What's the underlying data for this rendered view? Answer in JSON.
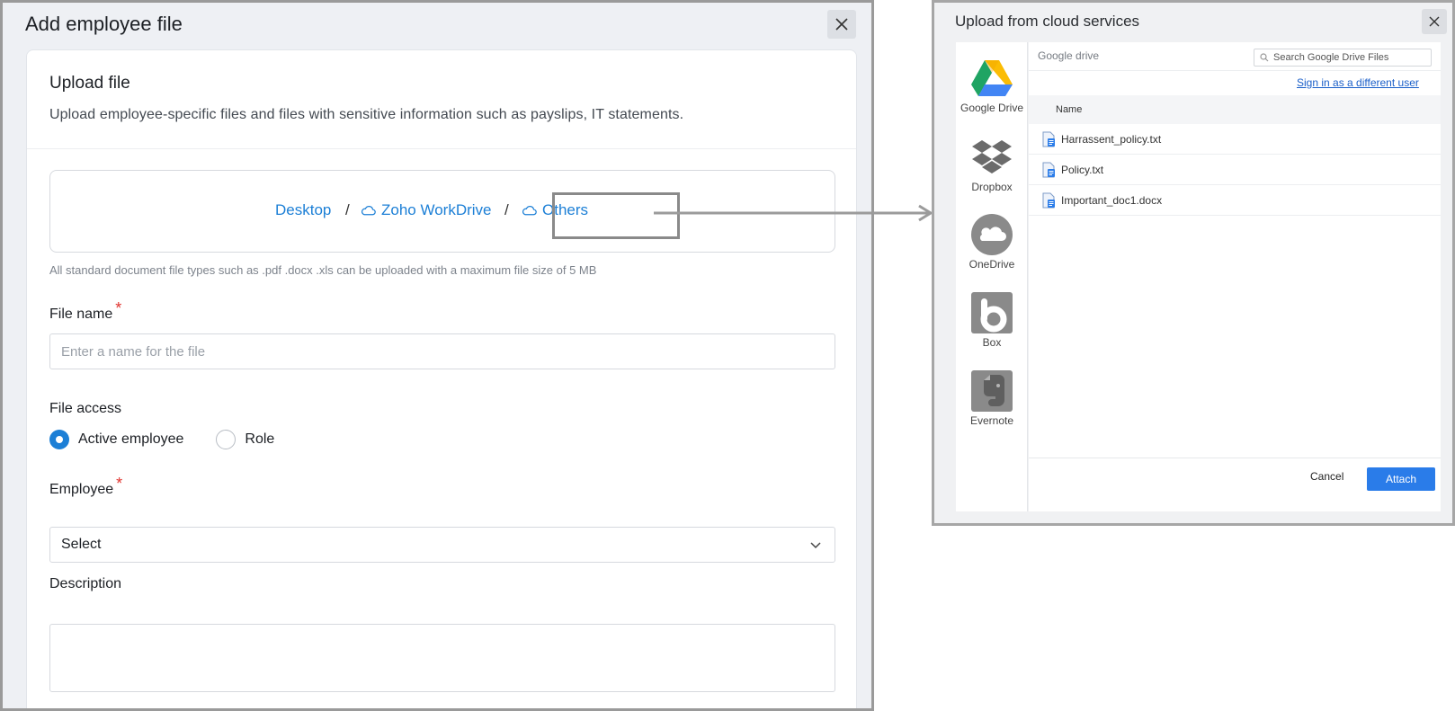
{
  "left_panel": {
    "title": "Add employee file",
    "upload": {
      "title": "Upload file",
      "description": "Upload employee-specific files and files with sensitive information such as payslips, IT statements.",
      "sources": {
        "desktop": "Desktop",
        "separator": "/",
        "workdrive": "Zoho WorkDrive",
        "others": "Others"
      },
      "hint": "All standard document file types such as .pdf .docx .xls can be uploaded with a maximum file size of 5 MB"
    },
    "file_name": {
      "label": "File name",
      "required_mark": "*",
      "placeholder": "Enter a name for the file"
    },
    "file_access": {
      "label": "File access",
      "options": [
        {
          "label": "Active employee",
          "selected": true
        },
        {
          "label": "Role",
          "selected": false
        }
      ]
    },
    "employee": {
      "label": "Employee",
      "required_mark": "*",
      "value": "Select"
    },
    "description": {
      "label": "Description"
    }
  },
  "cloud_dialog": {
    "title": "Upload from cloud services",
    "services": [
      {
        "label": "Google Drive",
        "icon": "google-drive-icon"
      },
      {
        "label": "Dropbox",
        "icon": "dropbox-icon"
      },
      {
        "label": "OneDrive",
        "icon": "onedrive-icon"
      },
      {
        "label": "Box",
        "icon": "box-icon"
      },
      {
        "label": "Evernote",
        "icon": "evernote-icon"
      }
    ],
    "breadcrumb": "Google drive",
    "search_placeholder": "Search Google Drive Files",
    "sign_in_link": "Sign in as a different user",
    "column_header": "Name",
    "files": [
      {
        "name": "Harrassent_policy.txt"
      },
      {
        "name": "Policy.txt"
      },
      {
        "name": "Important_doc1.docx"
      }
    ],
    "cancel_label": "Cancel",
    "attach_label": "Attach"
  },
  "colors": {
    "accent_blue": "#1c7fd6",
    "attach_blue": "#2a7ce9",
    "required_red": "#e0342f",
    "highlight_gray": "#8a8a8a"
  }
}
